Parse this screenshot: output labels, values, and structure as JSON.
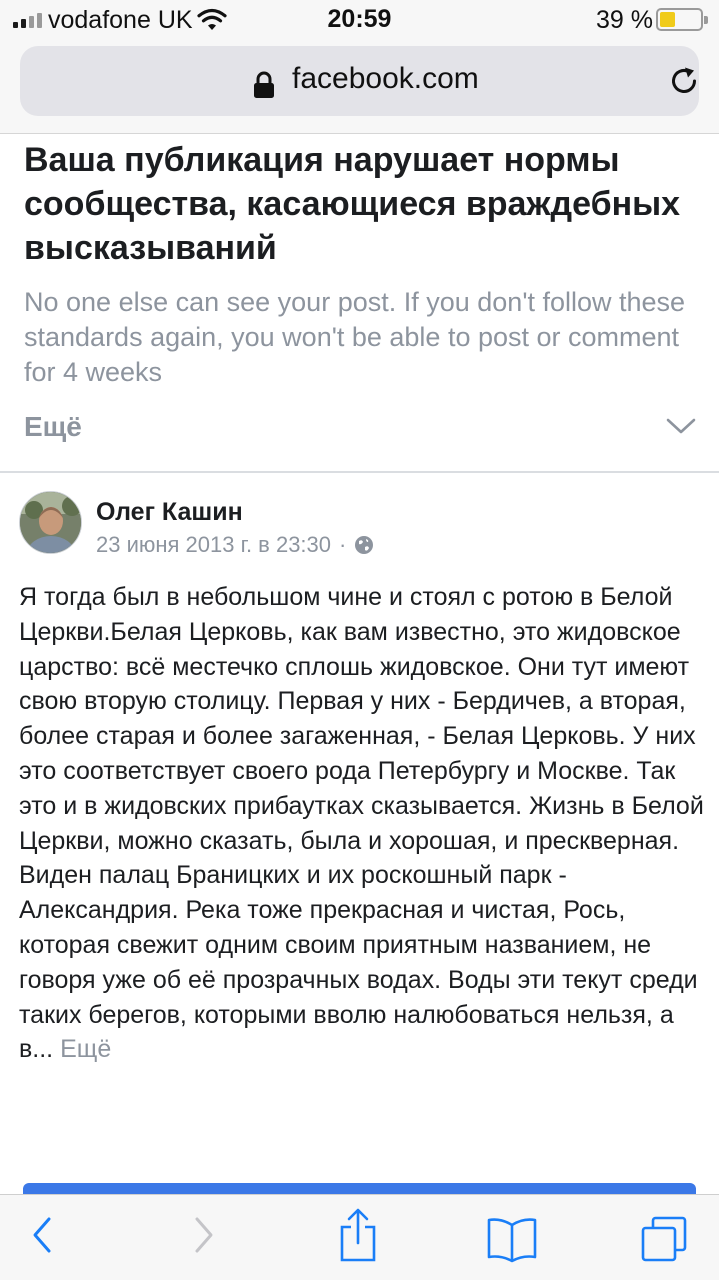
{
  "status_bar": {
    "carrier": "vodafone UK",
    "time": "20:59",
    "battery_percent": "39 %",
    "battery_level": 0.39
  },
  "browser": {
    "url": "facebook.com"
  },
  "notice": {
    "title": "Ваша публикация нарушает нормы сообщества, касающиеся враждебных высказываний",
    "body": "No one else can see your post. If you don't follow these standards again, you won't be able to post or comment for 4 weeks",
    "more_label": "Ещё"
  },
  "post": {
    "author": "Олег Кашин",
    "timestamp": "23 июня 2013 г. в 23:30",
    "separator": "·",
    "text": "Я тогда был в небольшом чине и стоял с ротою в Белой Церкви.Белая Церковь, как вам известно, это жидовское царство: всё местечко сплошь жидовское. Они тут имеют свою вторую столицу. Первая у них - Бердичев, а вторая, более старая и более загаженная, - Белая Церковь. У них это соответствует своего рода Петербургу и Москве. Так это и в жидовских прибаутках сказывается. Жизнь в Белой Церкви, можно сказать, была и хорошая, и прескверная. Виден палац Браницких и их роскошный парк - Александрия. Река тоже прекрасная и чистая, Рось, которая свежит одним своим приятным названием, не говоря уже об её прозрачных водах. Воды эти текут среди таких берегов, которыми вволю налюбоваться нельзя, а в...",
    "more_label": "Ещё"
  },
  "colors": {
    "accent": "#3b78e7",
    "ios_blue": "#1a7ef7",
    "muted_text": "#8d949e",
    "battery": "#f0cb1a"
  },
  "icons": {
    "wifi": "wifi-icon",
    "lock": "lock-icon",
    "reload": "reload-icon",
    "chevron": "chevron-down-icon",
    "audience": "globe-icon",
    "back": "back-arrow-icon",
    "forward": "forward-arrow-icon",
    "share": "share-icon",
    "bookmarks": "bookmarks-icon",
    "tabs": "tabs-icon"
  }
}
